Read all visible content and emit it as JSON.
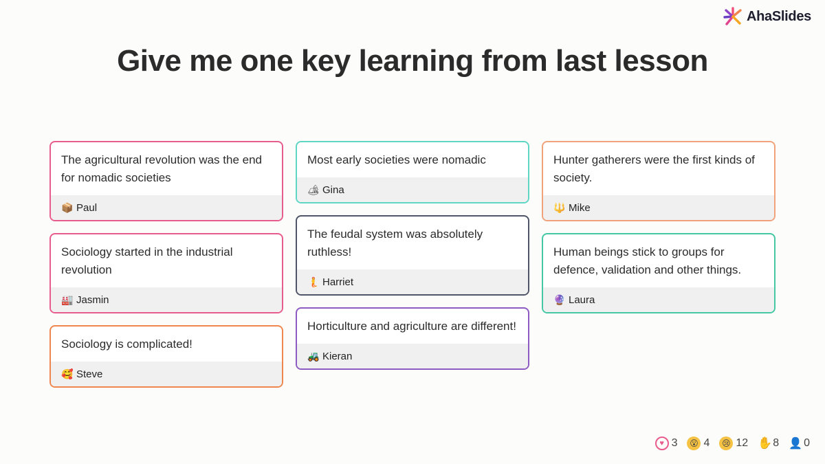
{
  "brand": {
    "name": "AhaSlides"
  },
  "title": "Give me one key learning from last lesson",
  "columns": [
    [
      {
        "text": "The agricultural revolution was the end for nomadic societies",
        "author": "Paul",
        "avatar": "📦",
        "avatar_icon": "box-icon",
        "border": "#e85b8d"
      },
      {
        "text": "Sociology started in the industrial revolution",
        "author": "Jasmin",
        "avatar": "🏭",
        "avatar_icon": "factory-icon",
        "border": "#e85b8d"
      },
      {
        "text": "Sociology is complicated!",
        "author": "Steve",
        "avatar": "🥰",
        "avatar_icon": "smiling-face-icon",
        "border": "#f0864f"
      }
    ],
    [
      {
        "text": "Most early societies were nomadic",
        "author": "Gina",
        "avatar": "🏕",
        "avatar_icon": "camping-icon",
        "border": "#5fd6c4"
      },
      {
        "text": "The feudal system was absolutely ruthless!",
        "author": "Harriet",
        "avatar": "🧜",
        "avatar_icon": "mermaid-icon",
        "border": "#4f5566"
      },
      {
        "text": "Horticulture and agriculture are different!",
        "author": "Kieran",
        "avatar": "🚜",
        "avatar_icon": "tractor-icon",
        "border": "#8e5bc2"
      }
    ],
    [
      {
        "text": "Hunter gatherers were the first kinds of society.",
        "author": "Mike",
        "avatar": "🔱",
        "avatar_icon": "trident-icon",
        "border": "#f0a27a"
      },
      {
        "text": "Human beings stick to groups for defence, validation and other things.",
        "author": "Laura",
        "avatar": "🔮",
        "avatar_icon": "crystal-ball-icon",
        "border": "#44c7a2"
      }
    ]
  ],
  "reactions": {
    "hearts": "3",
    "wow": "4",
    "sad": "12",
    "hands": "8",
    "users": "0"
  }
}
